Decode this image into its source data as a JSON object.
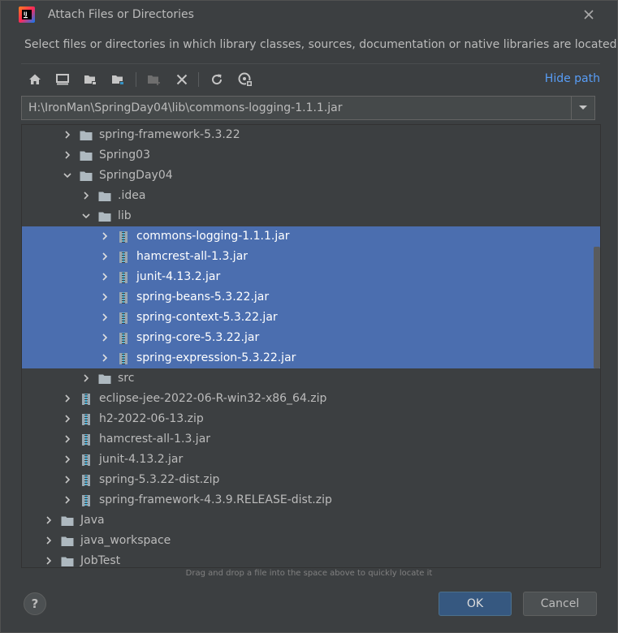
{
  "window": {
    "title": "Attach Files or Directories",
    "description": "Select files or directories in which library classes, sources, documentation or native libraries are located"
  },
  "toolbar": {
    "buttons": [
      "home-icon",
      "desktop-icon",
      "project-icon",
      "module-icon",
      "new-folder-icon",
      "delete-icon",
      "refresh-icon",
      "show-hidden-icon"
    ],
    "hide_path_label": "Hide path"
  },
  "path": {
    "value": "H:\\IronMan\\SpringDay04\\lib\\commons-logging-1.1.1.jar"
  },
  "tree": {
    "rows": [
      {
        "label": "spring-framework-5.3.22",
        "type": "folder",
        "level": 2,
        "expanded": false,
        "selected": false
      },
      {
        "label": "Spring03",
        "type": "folder",
        "level": 2,
        "expanded": false,
        "selected": false
      },
      {
        "label": "SpringDay04",
        "type": "folder",
        "level": 2,
        "expanded": true,
        "selected": false
      },
      {
        "label": ".idea",
        "type": "folder",
        "level": 3,
        "expanded": false,
        "selected": false
      },
      {
        "label": "lib",
        "type": "folder",
        "level": 3,
        "expanded": true,
        "selected": false
      },
      {
        "label": "commons-logging-1.1.1.jar",
        "type": "archive",
        "level": 4,
        "expanded": false,
        "selected": true
      },
      {
        "label": "hamcrest-all-1.3.jar",
        "type": "archive",
        "level": 4,
        "expanded": false,
        "selected": true
      },
      {
        "label": "junit-4.13.2.jar",
        "type": "archive",
        "level": 4,
        "expanded": false,
        "selected": true
      },
      {
        "label": "spring-beans-5.3.22.jar",
        "type": "archive",
        "level": 4,
        "expanded": false,
        "selected": true
      },
      {
        "label": "spring-context-5.3.22.jar",
        "type": "archive",
        "level": 4,
        "expanded": false,
        "selected": true
      },
      {
        "label": "spring-core-5.3.22.jar",
        "type": "archive",
        "level": 4,
        "expanded": false,
        "selected": true
      },
      {
        "label": "spring-expression-5.3.22.jar",
        "type": "archive",
        "level": 4,
        "expanded": false,
        "selected": true
      },
      {
        "label": "src",
        "type": "folder",
        "level": 3,
        "expanded": false,
        "selected": false
      },
      {
        "label": "eclipse-jee-2022-06-R-win32-x86_64.zip",
        "type": "archive",
        "level": 2,
        "expanded": false,
        "selected": false
      },
      {
        "label": "h2-2022-06-13.zip",
        "type": "archive",
        "level": 2,
        "expanded": false,
        "selected": false
      },
      {
        "label": "hamcrest-all-1.3.jar",
        "type": "archive",
        "level": 2,
        "expanded": false,
        "selected": false
      },
      {
        "label": "junit-4.13.2.jar",
        "type": "archive",
        "level": 2,
        "expanded": false,
        "selected": false
      },
      {
        "label": "spring-5.3.22-dist.zip",
        "type": "archive",
        "level": 2,
        "expanded": false,
        "selected": false
      },
      {
        "label": "spring-framework-4.3.9.RELEASE-dist.zip",
        "type": "archive",
        "level": 2,
        "expanded": false,
        "selected": false
      },
      {
        "label": "Java",
        "type": "folder",
        "level": 1,
        "expanded": false,
        "selected": false
      },
      {
        "label": "java_workspace",
        "type": "folder",
        "level": 1,
        "expanded": false,
        "selected": false
      },
      {
        "label": "JobTest",
        "type": "folder",
        "level": 1,
        "expanded": false,
        "selected": false
      }
    ]
  },
  "hint": "Drag and drop a file into the space above to quickly locate it",
  "buttons": {
    "help_label": "?",
    "ok_label": "OK",
    "cancel_label": "Cancel"
  },
  "colors": {
    "background": "#3c3f41",
    "selection": "#4b6eaf",
    "link": "#589df6",
    "ok_button": "#365880"
  }
}
